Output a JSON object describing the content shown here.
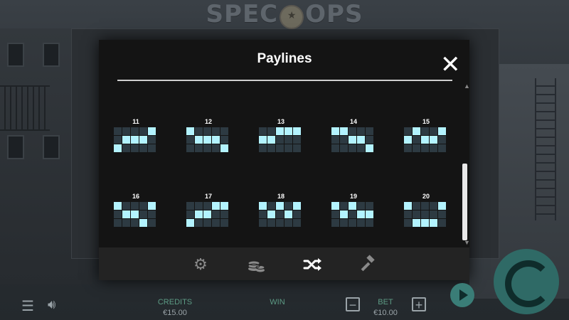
{
  "game": {
    "logo_left": "SPEC",
    "logo_right": "OPS"
  },
  "modal": {
    "title": "Paylines",
    "close_icon": "close-icon",
    "scroll_position": 0.7
  },
  "paylines": [
    {
      "number": "11",
      "pattern": [
        2,
        1,
        1,
        1,
        0
      ]
    },
    {
      "number": "12",
      "pattern": [
        0,
        1,
        1,
        1,
        2
      ]
    },
    {
      "number": "13",
      "pattern": [
        1,
        1,
        0,
        0,
        0
      ]
    },
    {
      "number": "14",
      "pattern": [
        0,
        0,
        1,
        1,
        2
      ]
    },
    {
      "number": "15",
      "pattern": [
        1,
        0,
        1,
        1,
        0
      ]
    },
    {
      "number": "16",
      "pattern": [
        0,
        1,
        1,
        2,
        0
      ]
    },
    {
      "number": "17",
      "pattern": [
        2,
        1,
        1,
        0,
        0
      ]
    },
    {
      "number": "18",
      "pattern": [
        0,
        1,
        0,
        1,
        0
      ]
    },
    {
      "number": "19",
      "pattern": [
        0,
        1,
        0,
        1,
        1
      ]
    },
    {
      "number": "20",
      "pattern": [
        0,
        2,
        2,
        2,
        0
      ]
    }
  ],
  "tabs": [
    {
      "icon": "gear-icon",
      "active": false
    },
    {
      "icon": "coins-icon",
      "active": false
    },
    {
      "icon": "shuffle-icon",
      "active": true
    },
    {
      "icon": "gavel-icon",
      "active": false
    }
  ],
  "bottom_bar": {
    "credits_label": "CREDITS",
    "credits_value": "€15.00",
    "win_label": "WIN",
    "bet_label": "BET",
    "bet_value": "€10.00"
  },
  "colors": {
    "accent": "#b3f3ff",
    "cell_off": "#2d3a42",
    "modal_bg": "#141414",
    "spin_button": "#2f6a66",
    "label_green": "#5c9a84"
  }
}
